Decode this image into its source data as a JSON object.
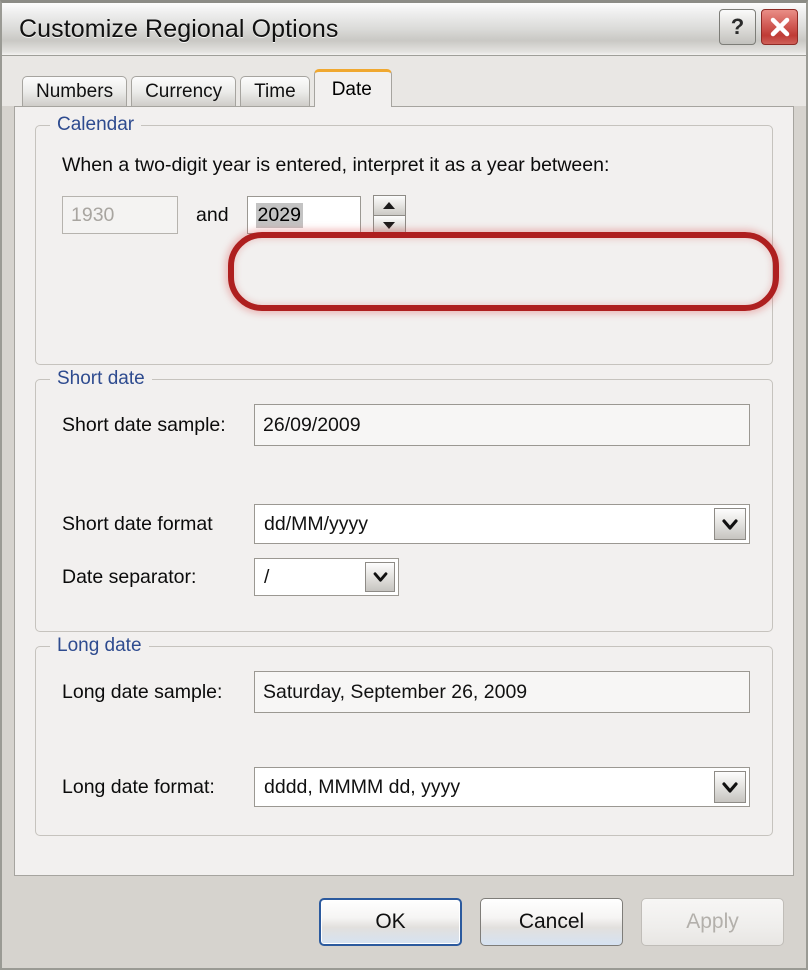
{
  "window": {
    "title": "Customize Regional Options",
    "help_button": "?",
    "close_button": "X"
  },
  "tabs": [
    {
      "label": "Numbers",
      "active": false
    },
    {
      "label": "Currency",
      "active": false
    },
    {
      "label": "Time",
      "active": false
    },
    {
      "label": "Date",
      "active": true
    }
  ],
  "calendar": {
    "legend": "Calendar",
    "instruction": "When a two-digit year is entered, interpret it as a year between:",
    "year_from": "1930",
    "and_label": "and",
    "year_to": "2029"
  },
  "short_date": {
    "legend": "Short date",
    "sample_label": "Short date sample:",
    "sample_value": "26/09/2009",
    "format_label": "Short date format",
    "format_value": "dd/MM/yyyy",
    "separator_label": "Date separator:",
    "separator_value": "/"
  },
  "long_date": {
    "legend": "Long date",
    "sample_label": "Long date sample:",
    "sample_value": "Saturday, September 26, 2009",
    "format_label": "Long date format:",
    "format_value": "dddd, MMMM dd, yyyy"
  },
  "footer": {
    "ok": "OK",
    "cancel": "Cancel",
    "apply": "Apply"
  },
  "colors": {
    "annotation": "#ae1f1f",
    "group_legend": "#2e4b8f",
    "active_tab_accent": "#f0a830",
    "close_button": "#bf3b35"
  }
}
